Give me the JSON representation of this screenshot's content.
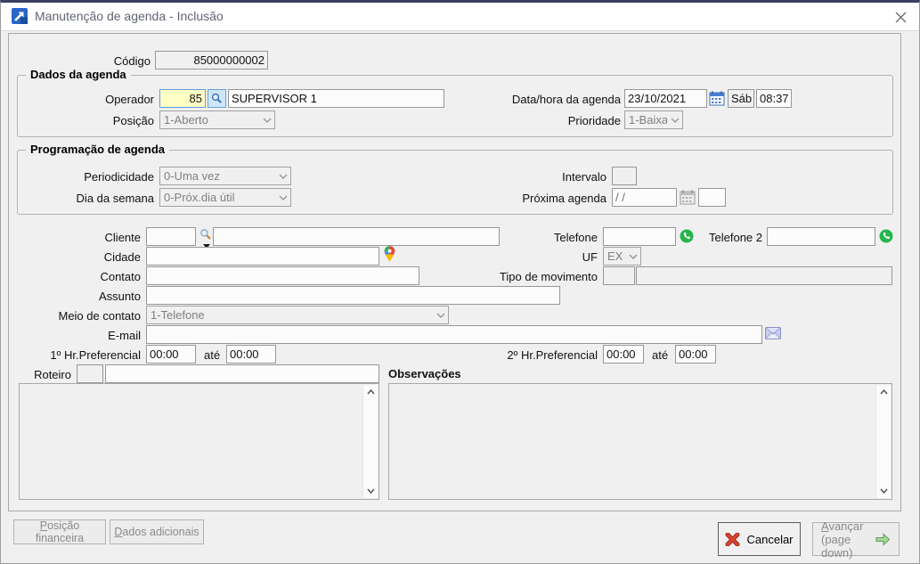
{
  "window": {
    "title": "Manutenção de agenda - Inclusão"
  },
  "codigo": {
    "label": "Código",
    "value": "85000000002"
  },
  "dados_agenda": {
    "title": "Dados da agenda",
    "operador_label": "Operador",
    "operador_code": "85",
    "operador_name": "SUPERVISOR 1",
    "posicao_label": "Posição",
    "posicao_value": "1-Aberto",
    "datahora_label": "Data/hora da agenda",
    "data_value": "23/10/2021",
    "weekday": "Sáb",
    "hora_value": "08:37",
    "prioridade_label": "Prioridade",
    "prioridade_value": "1-Baixa"
  },
  "programacao": {
    "title": "Programação de agenda",
    "periodicidade_label": "Periodicidade",
    "periodicidade_value": "0-Uma vez",
    "intervalo_label": "Intervalo",
    "dia_semana_label": "Dia da semana",
    "dia_semana_value": "0-Próx.dia útil",
    "proxima_agenda_label": "Próxima agenda",
    "proxima_agenda_value": "/ /"
  },
  "detalhes": {
    "cliente_label": "Cliente",
    "telefone_label": "Telefone",
    "telefone2_label": "Telefone 2",
    "cidade_label": "Cidade",
    "uf_label": "UF",
    "uf_value": "EX",
    "contato_label": "Contato",
    "tipo_movimento_label": "Tipo de movimento",
    "assunto_label": "Assunto",
    "meio_contato_label": "Meio de contato",
    "meio_contato_value": "1-Telefone",
    "email_label": "E-mail",
    "hr1_label": "1º Hr.Preferencial",
    "hr1_de": "00:00",
    "hr1_ate_label": "até",
    "hr1_ate": "00:00",
    "hr2_label": "2º Hr.Preferencial",
    "hr2_de": "00:00",
    "hr2_ate_label": "até",
    "hr2_ate": "00:00"
  },
  "notas": {
    "roteiro_label": "Roteiro",
    "observacoes_label": "Observações"
  },
  "footer": {
    "posicao_financeira_accel": "P",
    "posicao_financeira_rest": "osição financeira",
    "dados_adicionais_accel": "D",
    "dados_adicionais_rest": "ados adicionais",
    "cancelar": "Cancelar",
    "avancar_accel": "A",
    "avancar_rest": "vançar",
    "avancar_line2": "(page down)"
  },
  "icons": {
    "app": "blue square with white up-right arrow",
    "close": "gray x",
    "lookup": "blue magnifier button",
    "cliente_lookup": "magnifier with dropdown triangle",
    "calendar_active": "blue calendar grid",
    "calendar_disabled": "gray calendar grid",
    "whatsapp": "green circle white phone",
    "map_pin": "google maps multicolor pin",
    "email": "lavender envelope",
    "cancel": "red x",
    "advance": "green right arrow",
    "dropdown": "chevron down",
    "scroll_up": "chevron up",
    "scroll_down": "chevron down"
  },
  "colors": {
    "titlebar_top": "#3a3f63",
    "focus_yellow": "#ffffc5",
    "whatsapp_green": "#25b54b",
    "cancel_red": "#cc3b26",
    "advance_green": "#a6d895",
    "lookup_blue": "#cfe6fa"
  }
}
